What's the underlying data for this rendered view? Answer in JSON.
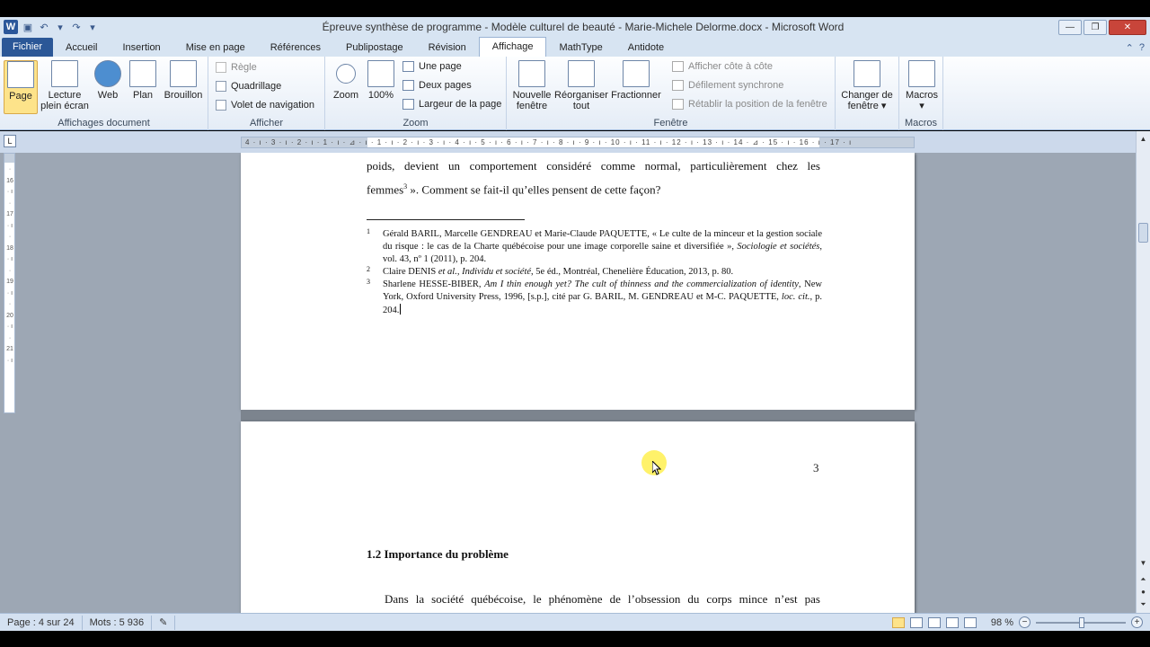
{
  "window": {
    "title": "Épreuve synthèse de programme - Modèle culturel de beauté - Marie-Michele Delorme.docx  -  Microsoft Word"
  },
  "tabs": [
    "Fichier",
    "Accueil",
    "Insertion",
    "Mise en page",
    "Références",
    "Publipostage",
    "Révision",
    "Affichage",
    "MathType",
    "Antidote"
  ],
  "ribbon": {
    "affichages": {
      "label": "Affichages document",
      "page": "Page",
      "lecture_l1": "Lecture",
      "lecture_l2": "plein écran",
      "web": "Web",
      "plan": "Plan",
      "brouillon": "Brouillon"
    },
    "afficher": {
      "label": "Afficher",
      "regle": "Règle",
      "quadrillage": "Quadrillage",
      "volet": "Volet de navigation"
    },
    "zoom": {
      "label": "Zoom",
      "zoom": "Zoom",
      "pct": "100%",
      "one_page": "Une page",
      "two_pages": "Deux pages",
      "page_width": "Largeur de la page"
    },
    "fenetre": {
      "label": "Fenêtre",
      "nouvelle_l1": "Nouvelle",
      "nouvelle_l2": "fenêtre",
      "reorg_l1": "Réorganiser",
      "reorg_l2": "tout",
      "fractionner": "Fractionner",
      "side_by_side": "Afficher côte à côte",
      "sync_scroll": "Défilement synchrone",
      "reset_pos": "Rétablir la position de la fenêtre",
      "changer_l1": "Changer de",
      "changer_l2": "fenêtre ▾"
    },
    "macros": {
      "label": "Macros",
      "macros": "Macros",
      "arrow": "▾"
    }
  },
  "ruler": {
    "marks": "4 · ı · 3 · ı · 2 · ı · 1 · ı · ⊿ · ı · 1 · ı · 2 · ı · 3 · ı · 4 · ı · 5 · ı · 6 · ı · 7 · ı · 8 · ı · 9 · ı · 10 · ı · 11 · ı · 12 · ı · 13 · ı · 14 · ⊿ · 15 · ı · 16 · ı · 17 · ı",
    "vertical_marks": "· 16 · ı · 17 · ı · 18 · ı · 19 · ı · 20 · ı · 21 · ı",
    "tab_selector": "L"
  },
  "document": {
    "page1": {
      "line1": "poids, devient un comportement considéré comme normal, particulièrement chez les",
      "line2_a": "femmes",
      "line2_sup": "3",
      "line2_b": " ». Comment se fait-il qu’elles pensent de cette façon?",
      "footnotes": [
        {
          "num": "1",
          "text_a": "Gérald BARIL, Marcelle GENDREAU et Marie-Claude PAQUETTE, « Le culte de la minceur et la gestion sociale du risque : le cas de la Charte québécoise pour une image corporelle saine et diversifiée », ",
          "text_i": "Sociologie et sociétés",
          "text_b": ", vol. 43, nº 1 (2011), p. 204."
        },
        {
          "num": "2",
          "text_a": "Claire DENIS ",
          "text_i": "et al., Individu et société",
          "text_b": ", 5e éd., Montréal, Chenelière Éducation, 2013, p. 80."
        },
        {
          "num": "3",
          "text_a": "Sharlene HESSE-BIBER, ",
          "text_i": "Am I thin enough yet? The cult of thinness and the commercialization of identity",
          "text_b": ", New York, Oxford University Press, 1996, [s.p.], cité par G. BARIL, M. GENDREAU et M-C. PAQUETTE, ",
          "text_i2": "loc. cit.",
          "text_c": ", p. 204."
        }
      ]
    },
    "page2": {
      "page_number": "3",
      "heading": "1.2 Importance du problème",
      "para_line1": "Dans la société québécoise, le phénomène de l’obsession du corps mince n’est pas"
    }
  },
  "status": {
    "page": "Page : 4 sur 24",
    "words": "Mots : 5 936",
    "zoom": "98 %",
    "zoom_minus": "−",
    "zoom_plus": "+"
  }
}
